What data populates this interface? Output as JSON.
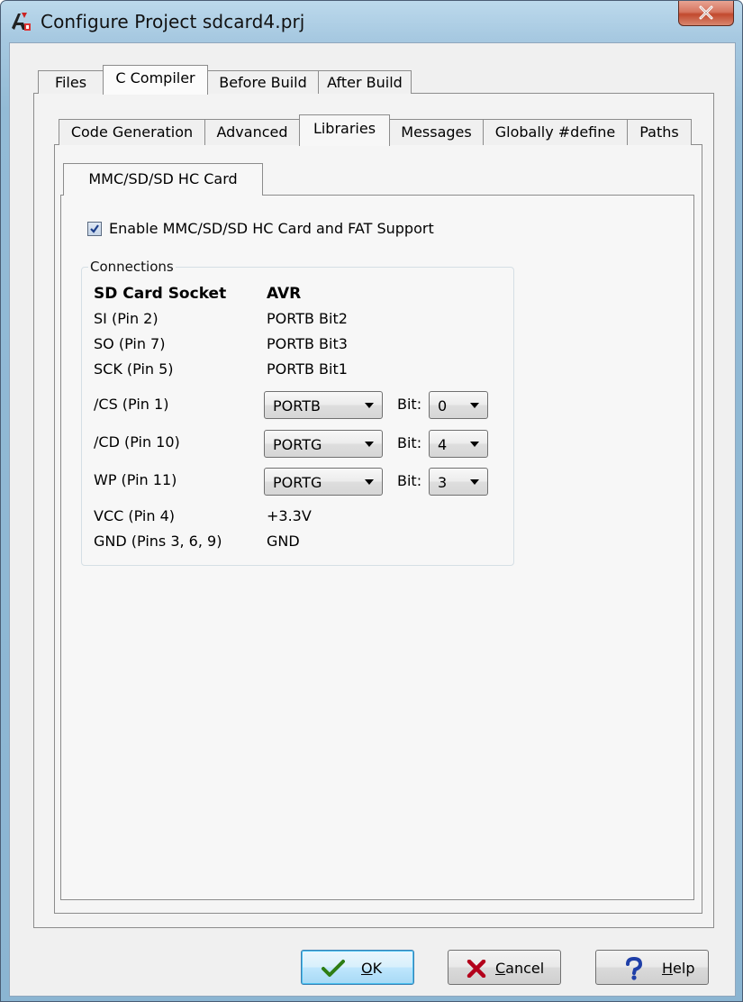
{
  "window": {
    "title": "Configure Project sdcard4.prj",
    "icon": "app-icon"
  },
  "main_tabs": [
    "Files",
    "C Compiler",
    "Before Build",
    "After Build"
  ],
  "main_tabs_active": "C Compiler",
  "sub_tabs": [
    "Code Generation",
    "Advanced",
    "Libraries",
    "Messages",
    "Globally #define",
    "Paths"
  ],
  "sub_tabs_active": "Libraries",
  "lib_tab": "MMC/SD/SD HC Card",
  "enable_checkbox": {
    "label": "Enable MMC/SD/SD HC Card and FAT Support",
    "checked": true
  },
  "connections": {
    "group_label": "Connections",
    "header_left": "SD Card Socket",
    "header_right": "AVR",
    "fixed_rows": [
      {
        "pin": "SI (Pin 2)",
        "avr": "PORTB Bit2"
      },
      {
        "pin": "SO (Pin 7)",
        "avr": "PORTB Bit3"
      },
      {
        "pin": "SCK (Pin 5)",
        "avr": "PORTB Bit1"
      }
    ],
    "select_rows": [
      {
        "pin": "/CS (Pin 1)",
        "port": "PORTB",
        "bit_label": "Bit:",
        "bit": "0"
      },
      {
        "pin": "/CD (Pin 10)",
        "port": "PORTG",
        "bit_label": "Bit:",
        "bit": "4"
      },
      {
        "pin": "WP (Pin 11)",
        "port": "PORTG",
        "bit_label": "Bit:",
        "bit": "3"
      }
    ],
    "power_rows": [
      {
        "pin": "VCC (Pin 4)",
        "avr": "+3.3V"
      },
      {
        "pin": "GND (Pins 3, 6, 9)",
        "avr": "GND"
      }
    ]
  },
  "buttons": {
    "ok": {
      "label_underlined": "O",
      "label_rest": "K",
      "icon": "checkmark-icon"
    },
    "cancel": {
      "label_underlined": "C",
      "label_rest": "ancel",
      "icon": "x-icon"
    },
    "help": {
      "label_underlined": "H",
      "label_rest": "elp",
      "icon": "question-icon"
    }
  },
  "colors": {
    "ok_check": "#2e7d14",
    "cancel_x": "#b3001b",
    "help_q": "#1f3fa8",
    "title_bar": "#a7c9e1",
    "close_button": "#c94c30"
  }
}
